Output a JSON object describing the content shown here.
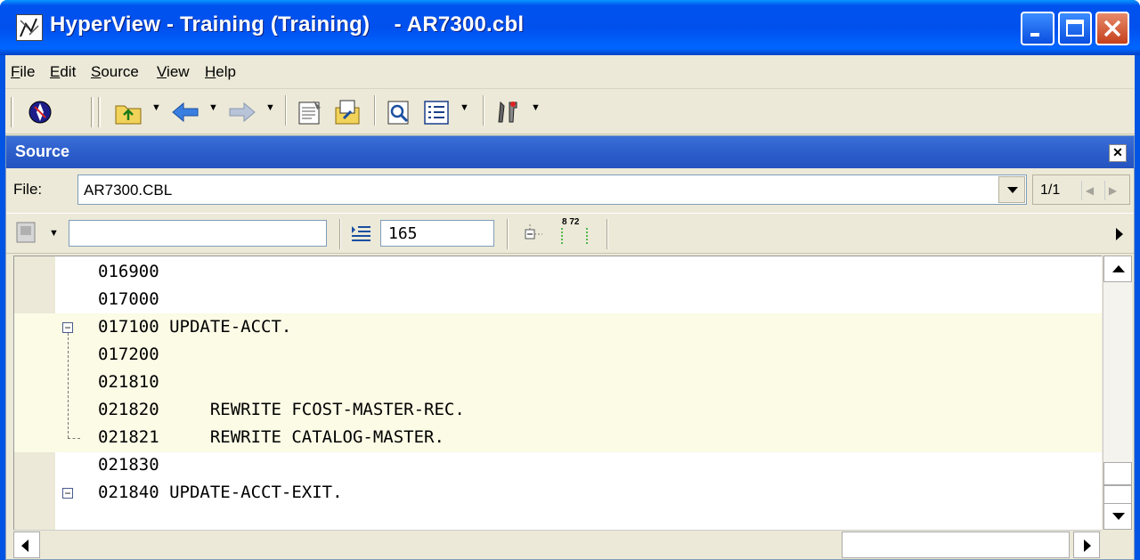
{
  "window": {
    "title": "HyperView - Training (Training)    - AR7300.cbl",
    "icons": {
      "app": "hyperview-app-icon",
      "minimize": "minimize-icon",
      "maximize": "maximize-icon",
      "close": "close-icon"
    }
  },
  "menu": {
    "items": [
      {
        "label": "File",
        "accel": "F",
        "rest": "ile"
      },
      {
        "label": "Edit",
        "accel": "E",
        "rest": "dit"
      },
      {
        "label": "Source",
        "accel": "S",
        "rest": "ource"
      },
      {
        "label": "View",
        "accel": "V",
        "rest": "iew"
      },
      {
        "label": "Help",
        "accel": "H",
        "rest": "elp"
      }
    ]
  },
  "toolbar": {
    "icons": [
      "compass-icon",
      "folder-up-icon",
      "back-arrow-icon",
      "forward-arrow-icon",
      "properties-icon",
      "edit-doc-icon",
      "find-icon",
      "list-view-icon",
      "tools-icon"
    ]
  },
  "panel": {
    "title": "Source",
    "file_label": "File:",
    "file_value": "AR7300.CBL",
    "pager": "1/1",
    "code_search_value": "",
    "line_number_value": "165",
    "ruler_label": "8 72"
  },
  "code": {
    "lines": [
      {
        "text": "016900",
        "highlight": false,
        "fold": ""
      },
      {
        "text": "017000",
        "highlight": false,
        "fold": ""
      },
      {
        "text": "017100 UPDATE-ACCT.",
        "highlight": true,
        "fold": "collapse"
      },
      {
        "text": "017200",
        "highlight": true,
        "fold": ""
      },
      {
        "text": "021810",
        "highlight": true,
        "fold": ""
      },
      {
        "text": "021820     REWRITE FCOST-MASTER-REC.",
        "highlight": true,
        "fold": ""
      },
      {
        "text": "021821     REWRITE CATALOG-MASTER.",
        "highlight": true,
        "fold": ""
      },
      {
        "text": "021830",
        "highlight": false,
        "fold": ""
      },
      {
        "text": "021840 UPDATE-ACCT-EXIT.",
        "highlight": false,
        "fold": "collapse"
      }
    ]
  },
  "colors": {
    "title_blue": "#0053ee",
    "panel_header": "#2a5bc8",
    "highlight_line": "#fbfbe6",
    "chrome": "#ece9d8"
  }
}
